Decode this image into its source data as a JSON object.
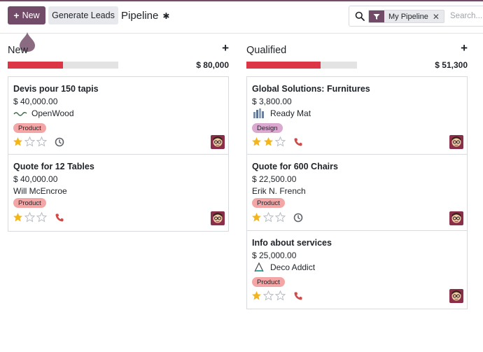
{
  "toolbar": {
    "new_label": "New",
    "generate_label": "Generate Leads"
  },
  "breadcrumb": {
    "title": "Pipeline"
  },
  "search": {
    "facet": "My Pipeline",
    "placeholder": "Search..."
  },
  "colors": {
    "brand": "#714b67",
    "progress_red": "#dc3545",
    "tag_product": "#f4a6a6",
    "tag_design": "#dba8d0",
    "star": "#f3b51a"
  },
  "columns": [
    {
      "name": "New",
      "total": "$ 80,000",
      "progress_fraction": 0.5,
      "cards": [
        {
          "title": "Devis pour 150 tapis",
          "amount": "$ 40,000.00",
          "customer": "OpenWood",
          "customer_icon": "openwood-logo",
          "tag": "Product",
          "stars": 1,
          "activity": "clock-icon"
        },
        {
          "title": "Quote for 12 Tables",
          "amount": "$ 40,000.00",
          "customer": "Will McEncroe",
          "tag": "Product",
          "stars": 1,
          "activity": "phone-icon"
        }
      ]
    },
    {
      "name": "Qualified",
      "total": "$ 51,300",
      "progress_fraction": 0.67,
      "cards": [
        {
          "title": "Global Solutions: Furnitures",
          "amount": "$ 3,800.00",
          "customer": "Ready Mat",
          "customer_icon": "readymat-logo",
          "tag": "Design",
          "stars": 2,
          "activity": "phone-icon"
        },
        {
          "title": "Quote for 600 Chairs",
          "amount": "$ 22,500.00",
          "customer": "Erik N. French",
          "tag": "Product",
          "stars": 1,
          "activity": "clock-icon"
        },
        {
          "title": "Info about services",
          "amount": "$ 25,000.00",
          "customer": "Deco Addict",
          "customer_icon": "decoaddict-logo",
          "tag": "Product",
          "stars": 1,
          "activity": "phone-icon"
        }
      ]
    }
  ]
}
